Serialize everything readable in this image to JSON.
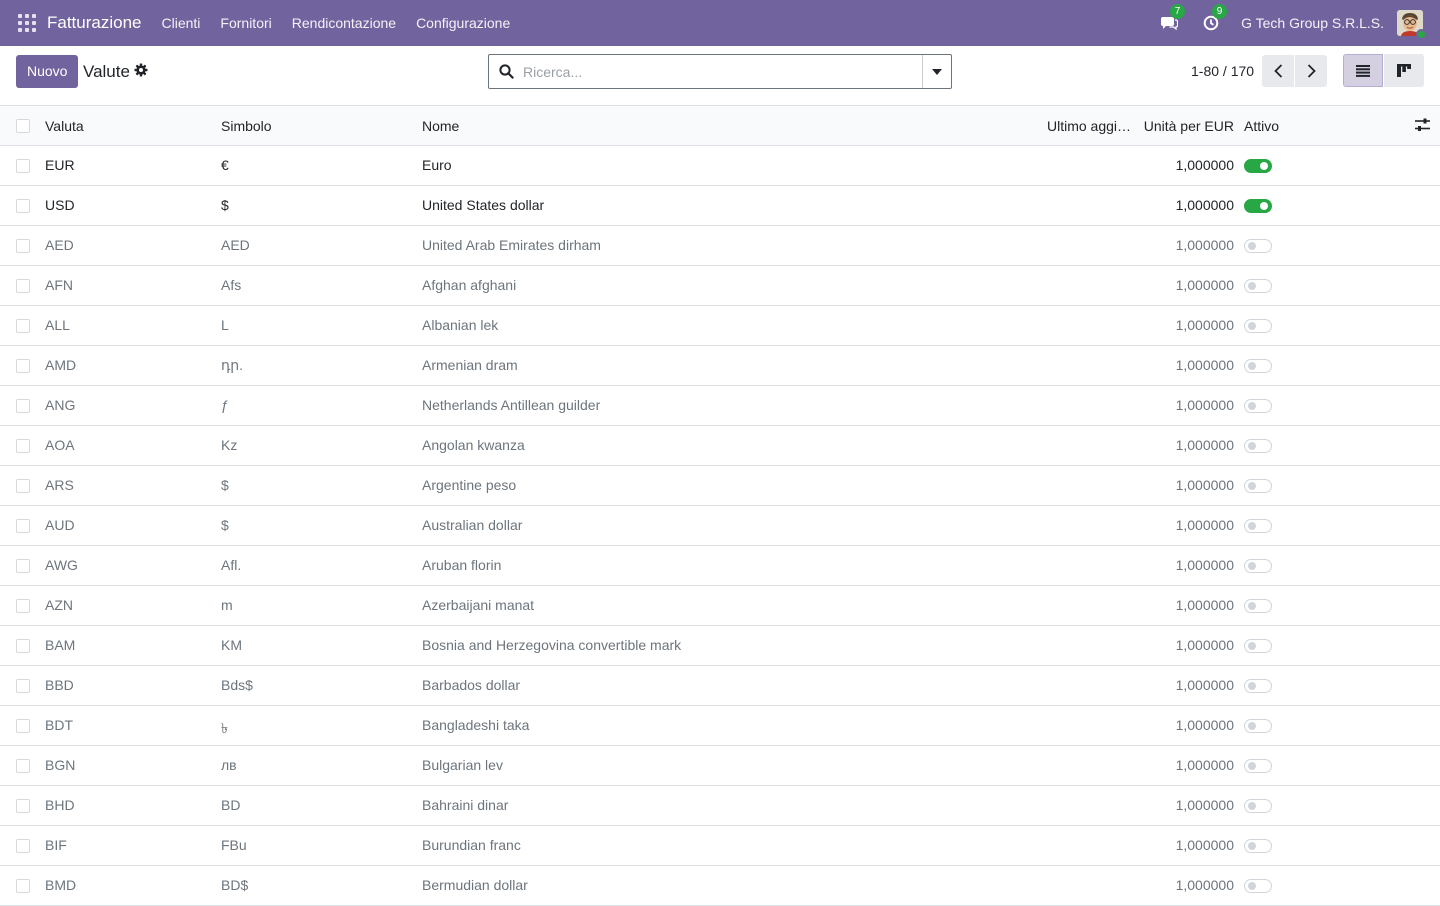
{
  "nav": {
    "app_name": "Fatturazione",
    "menu": [
      "Clienti",
      "Fornitori",
      "Rendicontazione",
      "Configurazione"
    ],
    "messages_count": "7",
    "activities_count": "9",
    "company": "G Tech Group S.R.L.S."
  },
  "control": {
    "new_label": "Nuovo",
    "title": "Valute",
    "search_placeholder": "Ricerca...",
    "pager": "1-80 / 170"
  },
  "table": {
    "headers": {
      "code": "Valuta",
      "symbol": "Simbolo",
      "name": "Nome",
      "last_update": "Ultimo aggi…",
      "rate": "Unità per EUR",
      "active": "Attivo"
    },
    "rows": [
      {
        "code": "EUR",
        "symbol": "€",
        "name": "Euro",
        "rate": "1,000000",
        "active": true
      },
      {
        "code": "USD",
        "symbol": "$",
        "name": "United States dollar",
        "rate": "1,000000",
        "active": true
      },
      {
        "code": "AED",
        "symbol": "AED",
        "name": "United Arab Emirates dirham",
        "rate": "1,000000",
        "active": false
      },
      {
        "code": "AFN",
        "symbol": "Afs",
        "name": "Afghan afghani",
        "rate": "1,000000",
        "active": false
      },
      {
        "code": "ALL",
        "symbol": "L",
        "name": "Albanian lek",
        "rate": "1,000000",
        "active": false
      },
      {
        "code": "AMD",
        "symbol": "դր.",
        "name": "Armenian dram",
        "rate": "1,000000",
        "active": false
      },
      {
        "code": "ANG",
        "symbol": "ƒ",
        "name": "Netherlands Antillean guilder",
        "rate": "1,000000",
        "active": false
      },
      {
        "code": "AOA",
        "symbol": "Kz",
        "name": "Angolan kwanza",
        "rate": "1,000000",
        "active": false
      },
      {
        "code": "ARS",
        "symbol": "$",
        "name": "Argentine peso",
        "rate": "1,000000",
        "active": false
      },
      {
        "code": "AUD",
        "symbol": "$",
        "name": "Australian dollar",
        "rate": "1,000000",
        "active": false
      },
      {
        "code": "AWG",
        "symbol": "Afl.",
        "name": "Aruban florin",
        "rate": "1,000000",
        "active": false
      },
      {
        "code": "AZN",
        "symbol": "m",
        "name": "Azerbaijani manat",
        "rate": "1,000000",
        "active": false
      },
      {
        "code": "BAM",
        "symbol": "KM",
        "name": "Bosnia and Herzegovina convertible mark",
        "rate": "1,000000",
        "active": false
      },
      {
        "code": "BBD",
        "symbol": "Bds$",
        "name": "Barbados dollar",
        "rate": "1,000000",
        "active": false
      },
      {
        "code": "BDT",
        "symbol": "৳",
        "name": "Bangladeshi taka",
        "rate": "1,000000",
        "active": false
      },
      {
        "code": "BGN",
        "symbol": "лв",
        "name": "Bulgarian lev",
        "rate": "1,000000",
        "active": false
      },
      {
        "code": "BHD",
        "symbol": "BD",
        "name": "Bahraini dinar",
        "rate": "1,000000",
        "active": false
      },
      {
        "code": "BIF",
        "symbol": "FBu",
        "name": "Burundian franc",
        "rate": "1,000000",
        "active": false
      },
      {
        "code": "BMD",
        "symbol": "BD$",
        "name": "Bermudian dollar",
        "rate": "1,000000",
        "active": false
      }
    ]
  },
  "colors": {
    "brand": "#71639e",
    "active_toggle": "#28a745"
  },
  "icons": [
    "apps-grid-icon",
    "chat-icon",
    "clock-icon",
    "search-icon",
    "caret-down-icon",
    "gear-icon",
    "chevron-left-icon",
    "chevron-right-icon",
    "list-view-icon",
    "kanban-view-icon",
    "optional-columns-icon"
  ]
}
